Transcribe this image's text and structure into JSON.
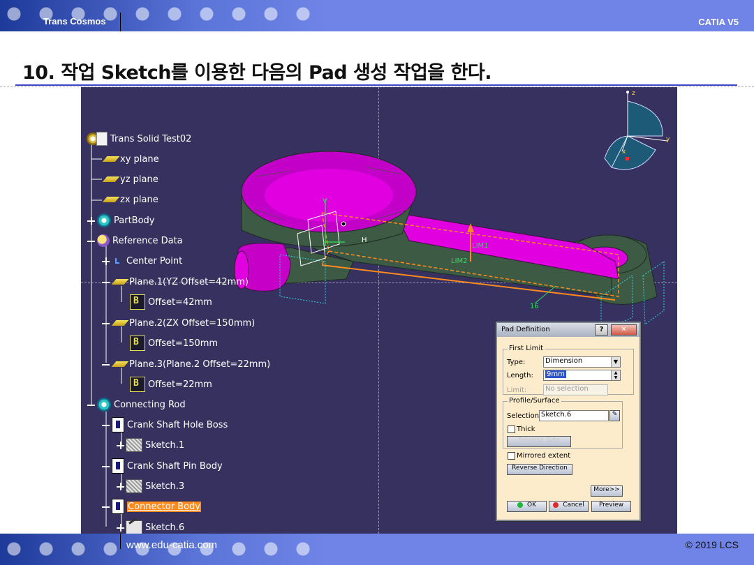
{
  "slide": {
    "header_left": "Trans Cosmos",
    "header_right": "CATIA V5",
    "title": "10. 작업 Sketch를 이용한 다음의 Pad 생성 작업을 한다.",
    "footer_url": "www.edu-catia.com",
    "footer_copy": "© 2019 LCS"
  },
  "tree": {
    "root": "Trans Solid Test02",
    "items": [
      {
        "label": "xy plane"
      },
      {
        "label": "yz plane"
      },
      {
        "label": "zx plane"
      },
      {
        "label": "PartBody"
      },
      {
        "label": "Reference Data"
      },
      {
        "label": "Center Point"
      },
      {
        "label": "Plane.1(YZ Offset=42mm)"
      },
      {
        "label": "Offset=42mm"
      },
      {
        "label": "Plane.2(ZX Offset=150mm)"
      },
      {
        "label": "Offset=150mm"
      },
      {
        "label": "Plane.3(Plane.2 Offset=22mm)"
      },
      {
        "label": "Offset=22mm"
      },
      {
        "label": "Connecting Rod"
      },
      {
        "label": "Crank Shaft Hole Boss"
      },
      {
        "label": "Sketch.1"
      },
      {
        "label": "Crank Shaft Pin Body"
      },
      {
        "label": "Sketch.3"
      },
      {
        "label": "Connector Body"
      },
      {
        "label": "Sketch.6"
      }
    ]
  },
  "viewport": {
    "compass": {
      "x": "x",
      "y": "y",
      "z": "z"
    },
    "annotations": {
      "lim1": "LIM1",
      "lim2": "LIM2",
      "dim": "16",
      "h": "H",
      "v": "V"
    }
  },
  "dialog": {
    "title": "Pad Definition",
    "help": "?",
    "close": "✕",
    "first_limit": {
      "legend": "First Limit",
      "type_label": "Type:",
      "type_value": "Dimension",
      "length_label": "Length:",
      "length_value": "9mm",
      "limit_label": "Limit:",
      "limit_value": "No selection"
    },
    "profile": {
      "legend": "Profile/Surface",
      "selection_label": "Selection:",
      "selection_value": "Sketch.6",
      "thick_label": "Thick",
      "reverse_side": "Reverse Side"
    },
    "mirrored_label": "Mirrored extent",
    "reverse_direction": "Reverse Direction",
    "more": "More>>",
    "ok": "OK",
    "cancel": "Cancel",
    "preview": "Preview"
  },
  "colors": {
    "viewport_bg": "#36315f",
    "part_magenta": "#e000e0",
    "part_green": "#3c5a44",
    "highlight_orange": "#ff8a1e",
    "dialog_bg": "#fdeccb"
  }
}
